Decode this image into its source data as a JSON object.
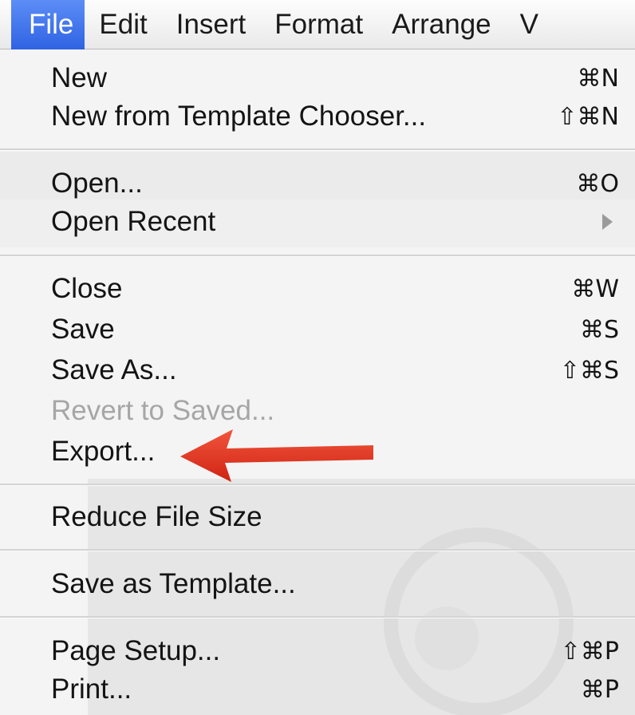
{
  "menubar": {
    "items": [
      "File",
      "Edit",
      "Insert",
      "Format",
      "Arrange",
      "V"
    ]
  },
  "menu": {
    "new_label": "New",
    "new_shortcut": "⌘N",
    "new_template_label": "New from Template Chooser...",
    "new_template_shortcut": "⇧⌘N",
    "open_label": "Open...",
    "open_shortcut": "⌘O",
    "open_recent_label": "Open Recent",
    "close_label": "Close",
    "close_shortcut": "⌘W",
    "save_label": "Save",
    "save_shortcut": "⌘S",
    "save_as_label": "Save As...",
    "save_as_shortcut": "⇧⌘S",
    "revert_label": "Revert to Saved...",
    "export_label": "Export...",
    "reduce_label": "Reduce File Size",
    "save_template_label": "Save as Template...",
    "page_setup_label": "Page Setup...",
    "page_setup_shortcut": "⇧⌘P",
    "print_label": "Print...",
    "print_shortcut": "⌘P"
  },
  "colors": {
    "menu_highlight": "#3a6ee8",
    "annotation_arrow": "#e5301c",
    "disabled_text": "#a6a6a6"
  }
}
